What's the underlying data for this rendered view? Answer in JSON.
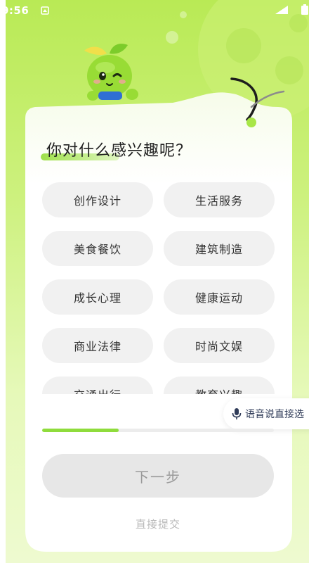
{
  "status_bar": {
    "time": "9:56",
    "notif_icon": "notification-icon",
    "signal_icon": "signal-icon",
    "battery_icon": "battery-icon"
  },
  "question": {
    "title": "你对什么感兴趣呢？"
  },
  "options": [
    {
      "label": "创作设计"
    },
    {
      "label": "生活服务"
    },
    {
      "label": "美食餐饮"
    },
    {
      "label": "建筑制造"
    },
    {
      "label": "成长心理"
    },
    {
      "label": "健康运动"
    },
    {
      "label": "商业法律"
    },
    {
      "label": "时尚文娱"
    },
    {
      "label": "交通出行"
    },
    {
      "label": "教育兴趣"
    }
  ],
  "voice": {
    "label": "语音说直接选",
    "icon": "microphone-icon"
  },
  "progress": {
    "fraction": 0.33
  },
  "actions": {
    "next_label": "下一步",
    "submit_label": "直接提交"
  },
  "colors": {
    "accent": "#8fdc3c",
    "background_top": "#b9ea55",
    "option_bg": "#f1f1f1",
    "button_disabled": "#e7e7e7"
  }
}
